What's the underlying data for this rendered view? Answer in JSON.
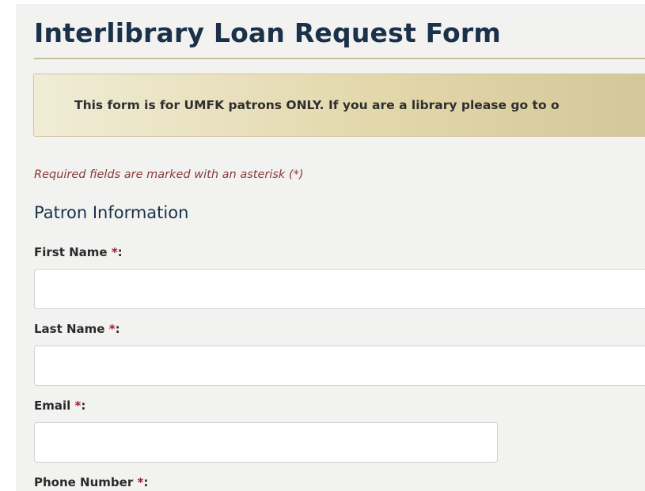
{
  "form": {
    "title": "Interlibrary Loan Request Form",
    "notice": "This form is for UMFK patrons ONLY. If you are a library please go to o",
    "required_note": "Required fields are marked with an asterisk (*)",
    "section_heading": "Patron Information",
    "fields": [
      {
        "label": "First Name ",
        "required_mark": "*",
        "suffix": ":",
        "value": ""
      },
      {
        "label": "Last Name ",
        "required_mark": "*",
        "suffix": ":",
        "value": ""
      },
      {
        "label": "Email ",
        "required_mark": "*",
        "suffix": ":",
        "value": ""
      },
      {
        "label": "Phone Number ",
        "required_mark": "*",
        "suffix": ":"
      }
    ]
  },
  "colors": {
    "title": "#1a3149",
    "notice_background": "#e3d8ac",
    "required_note": "#8a3a3a",
    "asterisk": "#9e1b32",
    "panel_background": "#f2f2f1"
  }
}
